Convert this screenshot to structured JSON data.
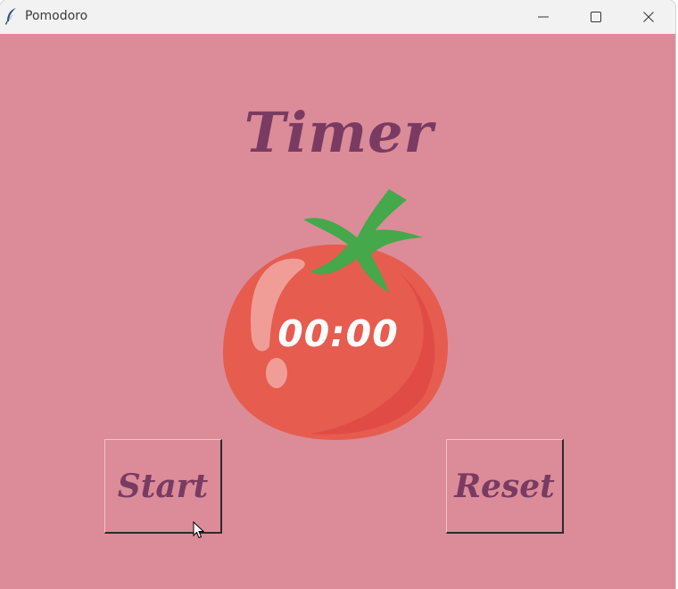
{
  "window": {
    "title": "Pomodoro",
    "app_icon": "feather-icon",
    "controls": [
      "minimize-icon",
      "maximize-icon",
      "close-icon"
    ]
  },
  "main": {
    "heading": "Timer",
    "time": "00:00",
    "image": "tomato-icon"
  },
  "buttons": {
    "start_label": "Start",
    "reset_label": "Reset"
  },
  "colors": {
    "background": "#db8c98",
    "text": "#7a3b62",
    "tomato": "#e65c4f",
    "leaf": "#45a84a"
  }
}
